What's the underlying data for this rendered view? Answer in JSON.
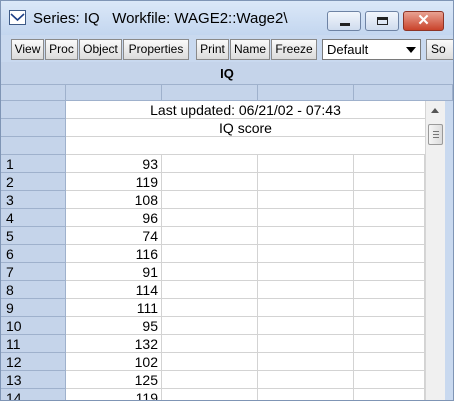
{
  "window": {
    "title": "Series: IQ   Workfile: WAGE2::Wage2\\",
    "icon": "series-icon",
    "controls": [
      "minimize-icon",
      "maximize-icon",
      "close-icon"
    ]
  },
  "toolbar": {
    "buttons": [
      "View",
      "Proc",
      "Object",
      "Properties",
      "Print",
      "Name",
      "Freeze"
    ],
    "dropdown_value": "Default",
    "cut_button": "So"
  },
  "sheet": {
    "series_name": "IQ",
    "last_updated": "Last updated: 06/21/02 - 07:43",
    "description": "IQ score",
    "rows": [
      {
        "obs": "1",
        "value": "93"
      },
      {
        "obs": "2",
        "value": "119"
      },
      {
        "obs": "3",
        "value": "108"
      },
      {
        "obs": "4",
        "value": "96"
      },
      {
        "obs": "5",
        "value": "74"
      },
      {
        "obs": "6",
        "value": "116"
      },
      {
        "obs": "7",
        "value": "91"
      },
      {
        "obs": "8",
        "value": "114"
      },
      {
        "obs": "9",
        "value": "111"
      },
      {
        "obs": "10",
        "value": "95"
      },
      {
        "obs": "11",
        "value": "132"
      },
      {
        "obs": "12",
        "value": "102"
      },
      {
        "obs": "13",
        "value": "125"
      },
      {
        "obs": "14",
        "value": "119"
      }
    ]
  },
  "colors": {
    "titlebar": "#c3d6ef",
    "header": "#c5d4ea",
    "close_button": "#c9432b"
  }
}
